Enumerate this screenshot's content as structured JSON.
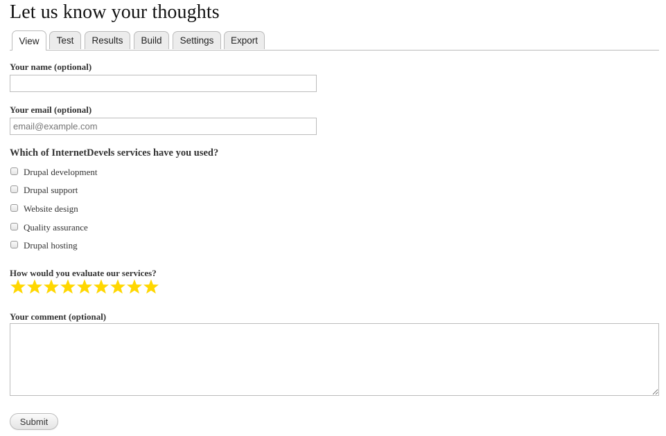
{
  "page": {
    "title": "Let us know your thoughts"
  },
  "tabs": [
    {
      "label": "View",
      "active": true
    },
    {
      "label": "Test",
      "active": false
    },
    {
      "label": "Results",
      "active": false
    },
    {
      "label": "Build",
      "active": false
    },
    {
      "label": "Settings",
      "active": false
    },
    {
      "label": "Export",
      "active": false
    }
  ],
  "form": {
    "name": {
      "label": "Your name (optional)",
      "value": "",
      "placeholder": ""
    },
    "email": {
      "label": "Your email (optional)",
      "value": "",
      "placeholder": "email@example.com"
    },
    "services": {
      "label": "Which of InternetDevels services have you used?",
      "options": [
        {
          "label": "Drupal development",
          "checked": false
        },
        {
          "label": "Drupal support",
          "checked": false
        },
        {
          "label": "Website design",
          "checked": false
        },
        {
          "label": "Quality assurance",
          "checked": false
        },
        {
          "label": "Drupal hosting",
          "checked": false
        }
      ]
    },
    "rating": {
      "label": "How would you evaluate our services?",
      "star_count": 9,
      "star_color": "#ffd700",
      "icon": "star-icon"
    },
    "comment": {
      "label": "Your comment (optional)",
      "value": ""
    },
    "submit_label": "Submit"
  }
}
